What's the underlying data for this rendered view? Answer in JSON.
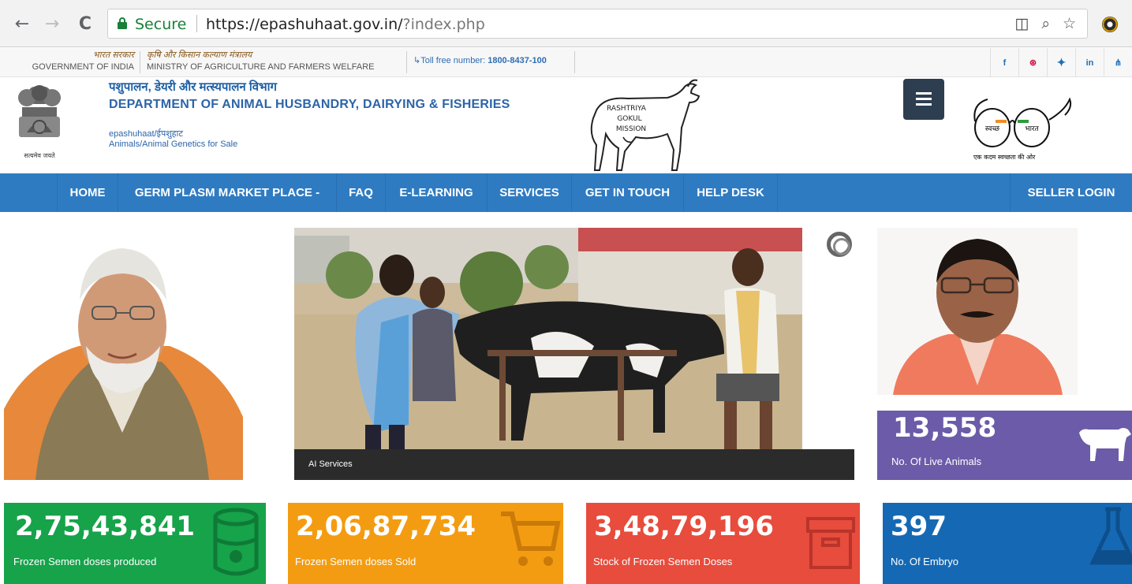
{
  "browser": {
    "secure_label": "Secure",
    "url_host": "https://epashuhaat.gov.in/",
    "url_rest": "?index.php",
    "back_glyph": "←",
    "forward_glyph": "→",
    "reload_glyph": "C",
    "icons": [
      "extension-shield-icon",
      "zoom-icon",
      "bookmark-star-icon",
      "profile-extension-icon"
    ]
  },
  "govbar": {
    "gov_hindi": "भारत सरकार",
    "gov_english": "GOVERNMENT OF INDIA",
    "ministry_hindi": "कृषि और किसान कल्याण मंत्रालय",
    "ministry_english": "MINISTRY OF AGRICULTURE AND FARMERS WELFARE",
    "toll_label": "Toll free number: ",
    "toll_number": "1800-8437-100",
    "social": [
      "f",
      "⊛",
      "🐦",
      "in",
      "⋔"
    ]
  },
  "header": {
    "dept_hindi": "पशुपालन, डेयरी और मत्स्यपालन विभाग",
    "dept_english": "DEPARTMENT OF ANIMAL HUSBANDRY, DAIRYING & FISHERIES",
    "site_name": "epashuhaat/ईपशुहाट",
    "site_tagline": "Animals/Animal Genetics for Sale",
    "emblem_motto": "सत्यमेव जयते",
    "gokul_line1": "RASHTRIYA",
    "gokul_line2": "GOKUL",
    "gokul_line3": "MISSION",
    "swachh_left": "स्वच्छ",
    "swachh_right": "भारत",
    "swachh_tag": "एक कदम स्वच्छता की ओर"
  },
  "nav": {
    "items": [
      "HOME",
      "GERM PLASM MARKET PLACE -",
      "FAQ",
      "E-LEARNING",
      "SERVICES",
      "GET IN TOUCH",
      "HELP DESK"
    ],
    "login": "SELLER LOGIN"
  },
  "slider": {
    "caption": "AI Services"
  },
  "stats": {
    "live_animals": {
      "value": "13,558",
      "label": "No. Of Live Animals",
      "color": "#6b5ba8"
    },
    "produced": {
      "value": "2,75,43,841",
      "label": "Frozen Semen doses produced",
      "color": "#16a34a"
    },
    "sold": {
      "value": "2,06,87,734",
      "label": "Frozen Semen doses Sold",
      "color": "#f39c12"
    },
    "stock": {
      "value": "3,48,79,196",
      "label": "Stock of Frozen Semen Doses",
      "color": "#e74c3c"
    },
    "embryo": {
      "value": "397",
      "label": "No. Of Embryo",
      "color": "#1569b4"
    }
  }
}
